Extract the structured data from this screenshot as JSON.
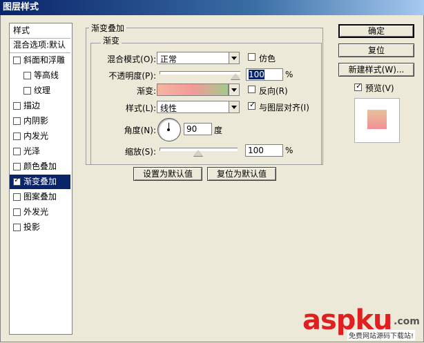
{
  "window": {
    "title": "图层样式"
  },
  "sidebar": {
    "header": "样式",
    "items": [
      {
        "label": "混合选项:默认",
        "checkbox": false,
        "checked": false,
        "indent": 0,
        "selected": false
      },
      {
        "label": "斜面和浮雕",
        "checkbox": true,
        "checked": false,
        "indent": 0,
        "selected": false
      },
      {
        "label": "等高线",
        "checkbox": true,
        "checked": false,
        "indent": 1,
        "selected": false
      },
      {
        "label": "纹理",
        "checkbox": true,
        "checked": false,
        "indent": 1,
        "selected": false
      },
      {
        "label": "描边",
        "checkbox": true,
        "checked": false,
        "indent": 0,
        "selected": false
      },
      {
        "label": "内阴影",
        "checkbox": true,
        "checked": false,
        "indent": 0,
        "selected": false
      },
      {
        "label": "内发光",
        "checkbox": true,
        "checked": false,
        "indent": 0,
        "selected": false
      },
      {
        "label": "光泽",
        "checkbox": true,
        "checked": false,
        "indent": 0,
        "selected": false
      },
      {
        "label": "颜色叠加",
        "checkbox": true,
        "checked": false,
        "indent": 0,
        "selected": false
      },
      {
        "label": "渐变叠加",
        "checkbox": true,
        "checked": true,
        "indent": 0,
        "selected": true
      },
      {
        "label": "图案叠加",
        "checkbox": true,
        "checked": false,
        "indent": 0,
        "selected": false
      },
      {
        "label": "外发光",
        "checkbox": true,
        "checked": false,
        "indent": 0,
        "selected": false
      },
      {
        "label": "投影",
        "checkbox": true,
        "checked": false,
        "indent": 0,
        "selected": false
      }
    ]
  },
  "overlay": {
    "group_title": "渐变叠加",
    "sub_title": "渐变",
    "blend_mode_label": "混合模式(O):",
    "blend_mode_value": "正常",
    "dither_label": "仿色",
    "opacity_label": "不透明度(P):",
    "opacity_value": "100",
    "opacity_unit": "%",
    "opacity_level": 1.0,
    "gradient_label": "渐变:",
    "reverse_label": "反向(R)",
    "style_label": "样式(L):",
    "style_value": "线性",
    "align_label": "与图层对齐(I)",
    "align_checked": true,
    "angle_label": "角度(N):",
    "angle_value": "90",
    "angle_unit": "度",
    "scale_label": "缩放(S):",
    "scale_value": "100",
    "scale_unit": "%",
    "scale_level": 0.5,
    "set_default_button": "设置为默认值",
    "reset_default_button": "复位为默认值",
    "gradient_colors": [
      "#f5b5a0",
      "#f29a9a",
      "#a4c98c"
    ]
  },
  "buttons": {
    "ok": "确定",
    "reset": "复位",
    "new_style": "新建样式(W)...",
    "preview_label": "预览(V)",
    "preview_checked": true
  },
  "preview": {
    "colors": [
      "#e7c39b",
      "#f28f94"
    ]
  },
  "watermark": {
    "brand": "aspku",
    "tld": ".com",
    "sub": "免费网站源码下载站!"
  }
}
